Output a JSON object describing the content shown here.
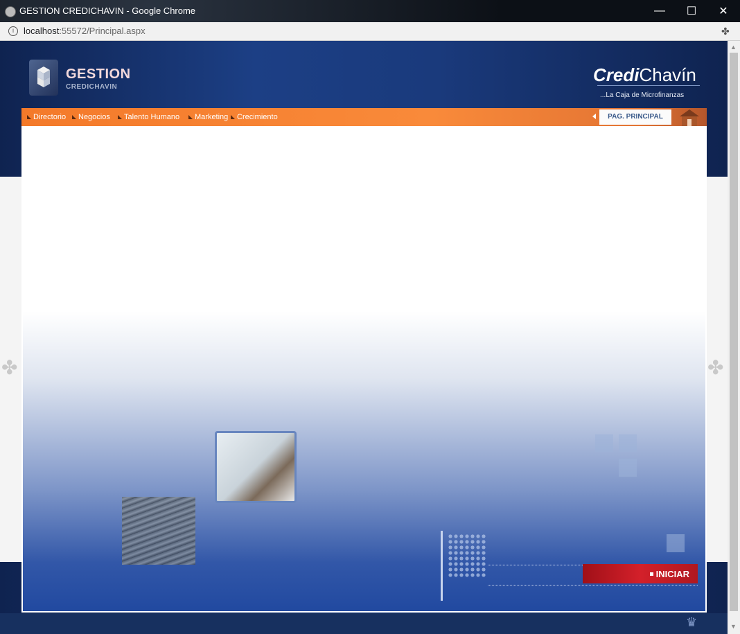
{
  "window": {
    "title": "GESTION CREDICHAVIN - Google Chrome",
    "minimize": "—",
    "maximize": "☐",
    "close": "✕"
  },
  "address": {
    "host": "localhost",
    "path": ":55572/Principal.aspx",
    "info": "i"
  },
  "header": {
    "logo_title": "GESTION",
    "logo_subtitle": "CREDICHAVIN",
    "brand_part1": "Credi",
    "brand_part2": "Chavín",
    "tagline": "...La Caja de Microfinanzas"
  },
  "nav": {
    "items": [
      "Directorio",
      "Negocios",
      "Talento Humano",
      "Marketing",
      "Crecimiento"
    ],
    "home": "PAG. PRINCIPAL"
  },
  "main": {
    "start_button": "INICIAR"
  },
  "icons": {
    "browser": "chrome-icon",
    "extension": "puzzle-icon",
    "side": "puzzle-icon",
    "footer": "crown-icon"
  },
  "colors": {
    "nav_orange": "#f47a2a",
    "brand_blue": "#1c3f85",
    "start_red": "#d3202a"
  }
}
